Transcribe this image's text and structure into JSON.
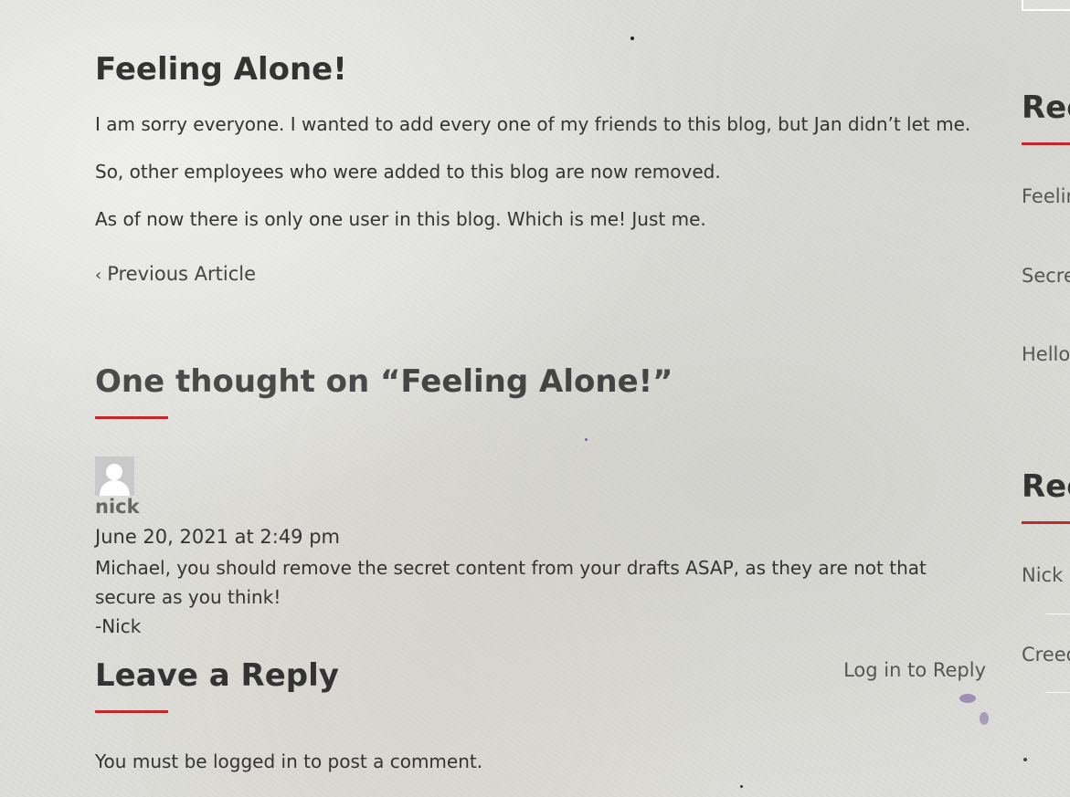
{
  "post": {
    "title": "Feeling Alone!",
    "paragraphs": [
      "I am sorry everyone. I wanted to add every one of my friends to this blog, but Jan didn’t let me.",
      "So, other employees who were added to this blog are now removed.",
      "As of now there is only one user in this blog. Which is me! Just me."
    ],
    "previous_article": "Previous Article"
  },
  "comments": {
    "title_prefix": "One thought on “",
    "title_post": "Feeling Alone!",
    "title_suffix": "”",
    "items": [
      {
        "author": "nick",
        "date": "June 20, 2021 at 2:49 pm",
        "text_lines": [
          "Michael, you should remove the secret content from your drafts ASAP, as they are not that secure as you think!",
          "-Nick"
        ],
        "reply_label": "Log in to Reply"
      }
    ]
  },
  "reply_form": {
    "title": "Leave a Reply",
    "must_prefix": "You must be ",
    "must_link": "logged in",
    "must_suffix": " to post a comment."
  },
  "sidebar": {
    "recent_posts_heading": "Rec",
    "recent_posts": [
      "Feelin",
      "Secre",
      "Hello"
    ],
    "recent_comments_heading": "Rec",
    "recent_comments": [
      "Nick o",
      "Creed"
    ]
  },
  "colors": {
    "accent": "#c0282c",
    "text": "#333333",
    "background": "#dcdcd8"
  }
}
